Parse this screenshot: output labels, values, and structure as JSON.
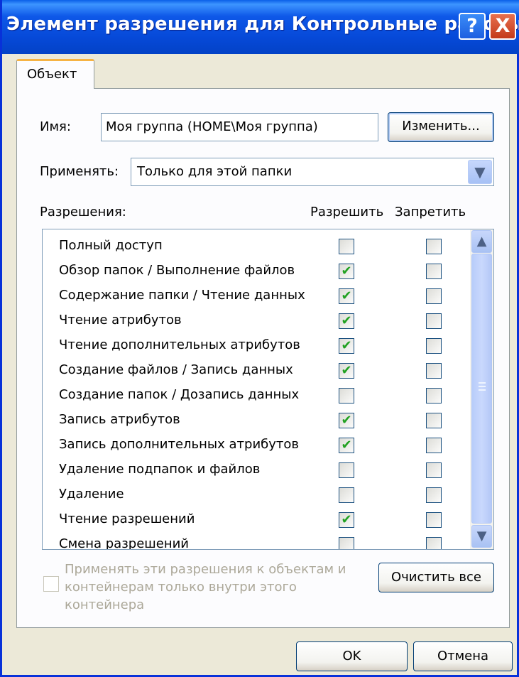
{
  "title": "Элемент разрешения для Контрольные работы",
  "title_buttons": {
    "help": "?",
    "close": "X"
  },
  "tab": "Объект",
  "name_label": "Имя:",
  "name_value": "Моя группа (HOME\\Моя группа)",
  "change_button": "Изменить...",
  "apply_label": "Применять:",
  "apply_value": "Только для этой папки",
  "permissions_header": "Разрешения:",
  "allow_header": "Разрешить",
  "deny_header": "Запретить",
  "permissions": [
    {
      "name": "Полный доступ",
      "allow": false,
      "deny": false
    },
    {
      "name": "Обзор папок / Выполнение файлов",
      "allow": true,
      "deny": false
    },
    {
      "name": "Содержание папки / Чтение данных",
      "allow": true,
      "deny": false
    },
    {
      "name": "Чтение атрибутов",
      "allow": true,
      "deny": false
    },
    {
      "name": "Чтение дополнительных атрибутов",
      "allow": true,
      "deny": false
    },
    {
      "name": "Создание файлов / Запись данных",
      "allow": true,
      "deny": false
    },
    {
      "name": "Создание папок / Дозапись данных",
      "allow": false,
      "deny": false
    },
    {
      "name": "Запись атрибутов",
      "allow": true,
      "deny": false
    },
    {
      "name": "Запись дополнительных атрибутов",
      "allow": true,
      "deny": false
    },
    {
      "name": "Удаление подпапок и файлов",
      "allow": false,
      "deny": false
    },
    {
      "name": "Удаление",
      "allow": false,
      "deny": false
    },
    {
      "name": "Чтение разрешений",
      "allow": true,
      "deny": false
    },
    {
      "name": "Смена разрешений",
      "allow": false,
      "deny": false
    }
  ],
  "apply_inside_text": "Применять эти разрешения к объектам и контейнерам только внутри этого контейнера",
  "clear_all_button": "Очистить все",
  "ok_button": "OK",
  "cancel_button": "Отмена",
  "icons": {
    "scroll_up": "▲",
    "scroll_down": "▼",
    "dropdown": "▼",
    "check": "✔"
  }
}
